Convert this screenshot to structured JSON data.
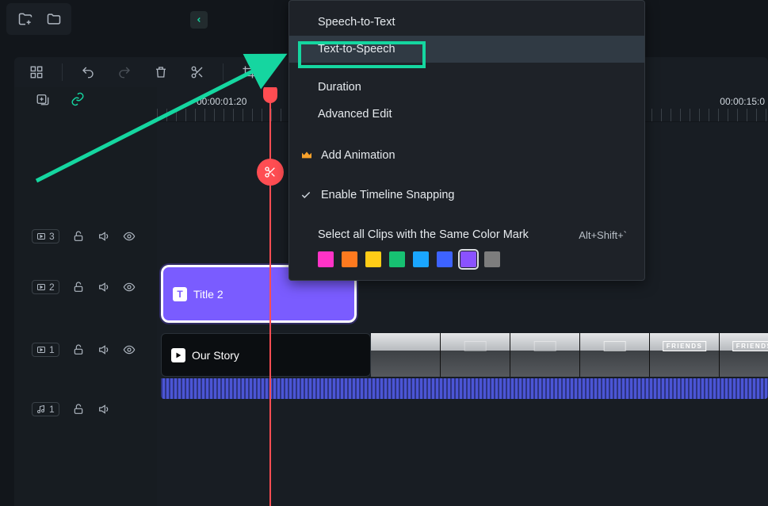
{
  "topbar": {
    "icons": [
      "folder-plus",
      "folder"
    ]
  },
  "toolbar": {
    "icons": [
      "grid",
      "undo",
      "redo",
      "trash",
      "scissors",
      "crop"
    ]
  },
  "ruler": {
    "t1": "00:00:01:20",
    "t2": "00:00:15:0"
  },
  "tracks": {
    "video3": {
      "kind": "video",
      "index": "3"
    },
    "video2": {
      "kind": "video",
      "index": "2"
    },
    "video1": {
      "kind": "video",
      "index": "1"
    },
    "audio1": {
      "kind": "audio",
      "index": "1"
    }
  },
  "clips": {
    "title2": "Title 2",
    "ourstory": "Our Story",
    "friends_tag": "FRIENDS"
  },
  "context_menu": {
    "speech_to_text": "Speech-to-Text",
    "text_to_speech": "Text-to-Speech",
    "duration": "Duration",
    "advanced_edit": "Advanced Edit",
    "add_animation": "Add Animation",
    "enable_snapping": "Enable Timeline Snapping",
    "select_same_color": "Select all Clips with the Same Color Mark",
    "select_same_color_shortcut": "Alt+Shift+`",
    "swatches": [
      "#ff33c7",
      "#ff7a1f",
      "#ffcc17",
      "#17c172",
      "#1aa6ff",
      "#3d63ff",
      "#8a52ff",
      "#7d7d7d"
    ],
    "swatch_outlined_index": 6
  }
}
